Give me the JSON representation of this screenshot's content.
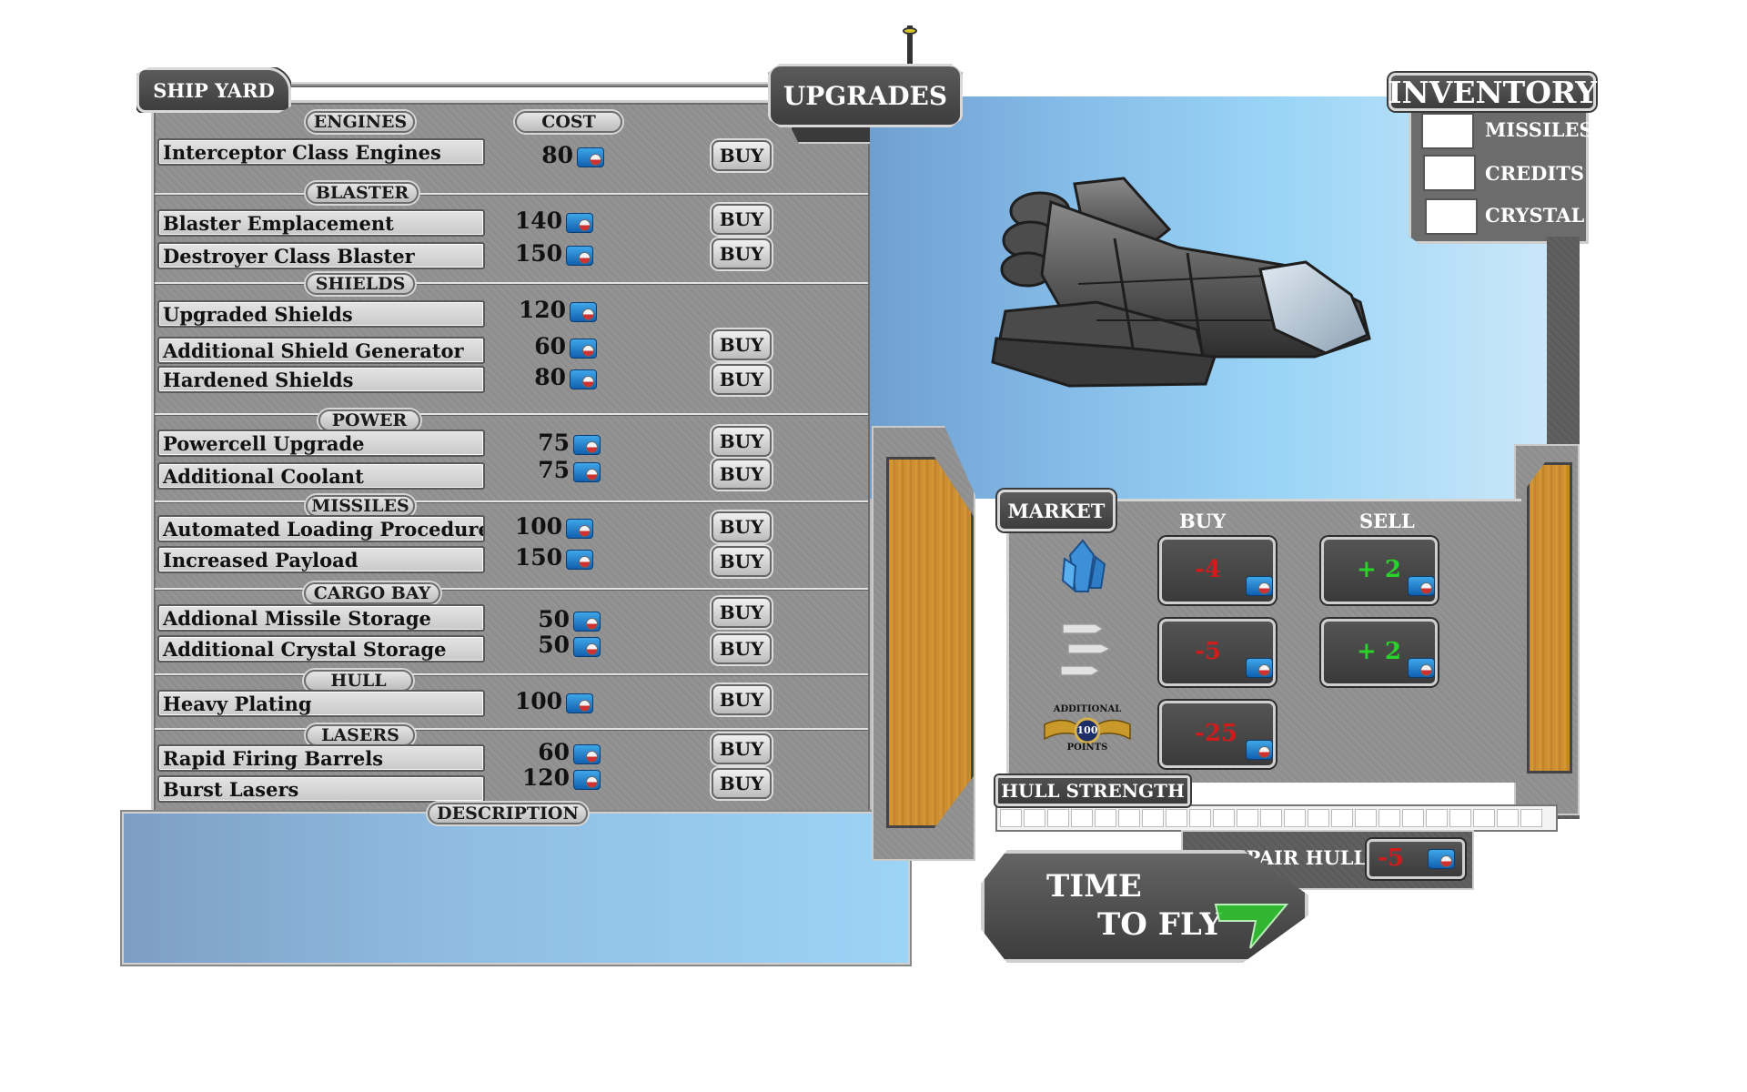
{
  "shipyard": {
    "title": "SHIP YARD",
    "cost_header": "COST",
    "buy_label": "BUY",
    "sections": [
      {
        "name": "ENGINES",
        "items": [
          {
            "label": "Interceptor Class Engines",
            "cost": "80",
            "buy": true
          }
        ]
      },
      {
        "name": "BLASTER",
        "items": [
          {
            "label": "Blaster Emplacement",
            "cost": "140",
            "buy": true
          },
          {
            "label": "Destroyer Class Blaster",
            "cost": "150",
            "buy": true
          }
        ]
      },
      {
        "name": "SHIELDS",
        "items": [
          {
            "label": "Upgraded Shields",
            "cost": "120",
            "buy": false
          },
          {
            "label": "Additional Shield Generator",
            "cost": "60",
            "buy": true
          },
          {
            "label": "Hardened Shields",
            "cost": "80",
            "buy": true
          }
        ]
      },
      {
        "name": "POWER",
        "items": [
          {
            "label": "Powercell Upgrade",
            "cost": "75",
            "buy": true
          },
          {
            "label": "Additional Coolant",
            "cost": "75",
            "buy": true
          }
        ]
      },
      {
        "name": "MISSILES",
        "items": [
          {
            "label": "Automated Loading Procedures",
            "cost": "100",
            "buy": true
          },
          {
            "label": "Increased Payload",
            "cost": "150",
            "buy": true
          }
        ]
      },
      {
        "name": "CARGO BAY",
        "items": [
          {
            "label": "Addional Missile Storage",
            "cost": "50",
            "buy": true
          },
          {
            "label": "Additional Crystal Storage",
            "cost": "50",
            "buy": true
          }
        ]
      },
      {
        "name": "HULL",
        "items": [
          {
            "label": "Heavy Plating",
            "cost": "100",
            "buy": true
          }
        ]
      },
      {
        "name": "LASERS",
        "items": [
          {
            "label": "Rapid Firing Barrels",
            "cost": "60",
            "buy": true
          },
          {
            "label": "Burst Lasers",
            "cost": "120",
            "buy": true
          }
        ]
      }
    ],
    "description_label": "DESCRIPTION",
    "description_text": ""
  },
  "upgrades_title": "UPGRADES",
  "inventory": {
    "title": "INVENTORY",
    "items": [
      {
        "label": "MISSILES",
        "value": ""
      },
      {
        "label": "CREDITS",
        "value": ""
      },
      {
        "label": "CRYSTAL",
        "value": ""
      }
    ]
  },
  "market": {
    "title": "MARKET",
    "buy_header": "BUY",
    "sell_header": "SELL",
    "rows": [
      {
        "icon": "crystal-icon",
        "buy": "-4",
        "sell": "+ 2"
      },
      {
        "icon": "missiles-icon",
        "buy": "-5",
        "sell": "+ 2"
      },
      {
        "icon": "additional-points-badge-icon",
        "badge_top": "ADDITIONAL",
        "badge_value": "100",
        "badge_bottom": "POINTS",
        "buy": "-25",
        "sell": null
      }
    ]
  },
  "hull": {
    "label": "HULL STRENGTH",
    "filled_segments": 0,
    "total_segments": 23
  },
  "repair": {
    "label": "REPAIR HULL",
    "cost": "-5"
  },
  "fly_button": {
    "line1": "TIME",
    "line2": "TO FLY"
  },
  "colors": {
    "negative": "#d11c1c",
    "positive": "#2ad32a",
    "credit_blue": "#1f7fd0",
    "wood": "#c98a2c"
  }
}
